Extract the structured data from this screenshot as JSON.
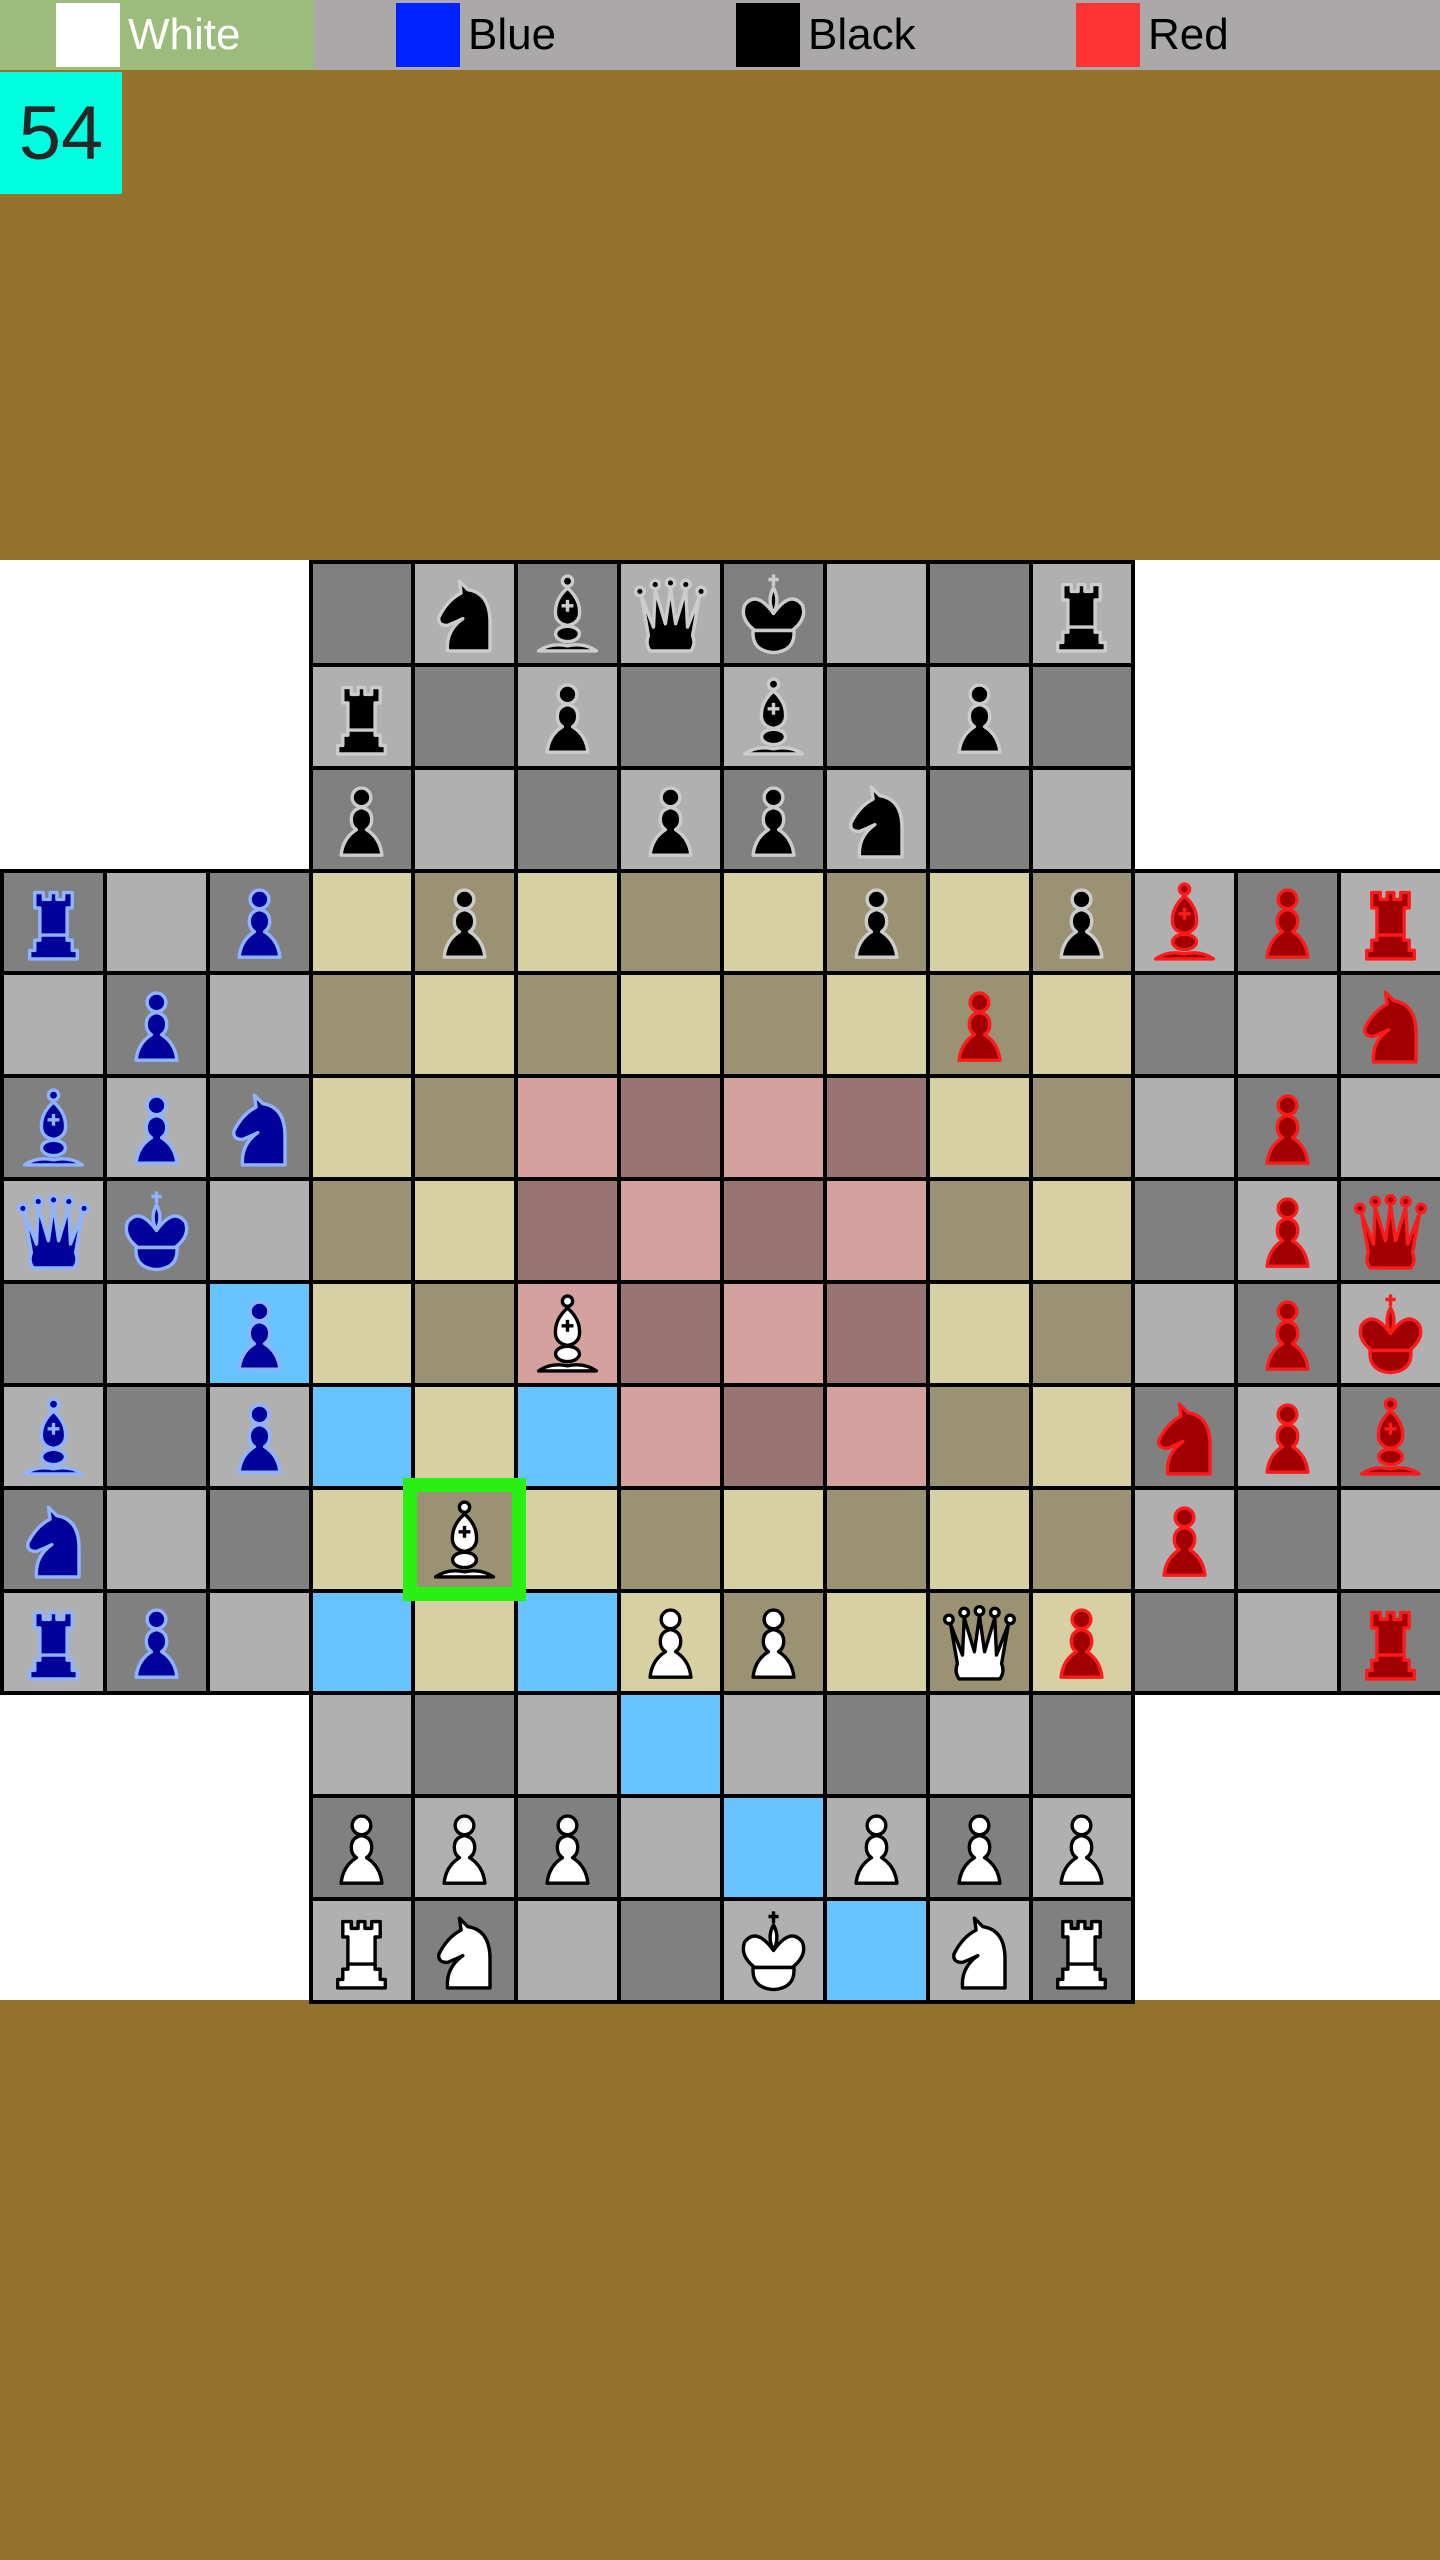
{
  "players": [
    {
      "name": "White",
      "color": "#ffffff",
      "active": true
    },
    {
      "name": "Blue",
      "color": "#0022ff",
      "active": false
    },
    {
      "name": "Black",
      "color": "#000000",
      "active": false
    },
    {
      "name": "Red",
      "color": "#ff3333",
      "active": false
    }
  ],
  "move_counter": "54",
  "colors": {
    "arm_light": "#b0b0b0",
    "arm_dark": "#808080",
    "center_light": "#d6d0a2",
    "center_dark": "#9a9272",
    "core_light": "#d4a19f",
    "core_dark": "#987472",
    "highlight": "#68c4ff",
    "selected": "#28f012",
    "background": "#93722c"
  },
  "piece_colors": {
    "w": {
      "fill": "#ffffff",
      "stroke": "#000000"
    },
    "b": {
      "fill": "#000000",
      "stroke": "#cccccc"
    },
    "u": {
      "fill": "#00009a",
      "stroke": "#8fb4ff"
    },
    "r": {
      "fill": "#a00000",
      "stroke": "#ff1a1a"
    }
  },
  "board": {
    "size": 14,
    "rows": [
      ". . . . bN bB bQ bK . . bR . . .",
      ". . . bR . bP . bB . bP . . . .",
      ". . . bP . . bP bP bN . . . . .",
      "uR . uP . bP . . . bP . bP rB rP rR",
      ". uP . . . . . . . rP . . . rN",
      "uB uP uN . . . . . . . . . rP .",
      "uQ uK . . . . . . . . . . rP rQ",
      ". . uP . . wB . . . . . . rP rK",
      "uB . uP . . . . . . . . rN rP rB",
      "uN . . . wB . . . . . . rP . .",
      "uR uP . . . . wP wP . wQ rP . . rR",
      ". . . . . . . . . . . . . .",
      ". . . wP wP wP . . wP wP wP . . .",
      ". . . wR wN . . wK . wN wR . . ."
    ],
    "highlighted": [
      [
        7,
        2
      ],
      [
        8,
        3
      ],
      [
        8,
        5
      ],
      [
        10,
        3
      ],
      [
        10,
        5
      ],
      [
        11,
        6
      ],
      [
        12,
        7
      ],
      [
        13,
        8
      ]
    ],
    "selected": [
      9,
      4
    ]
  }
}
